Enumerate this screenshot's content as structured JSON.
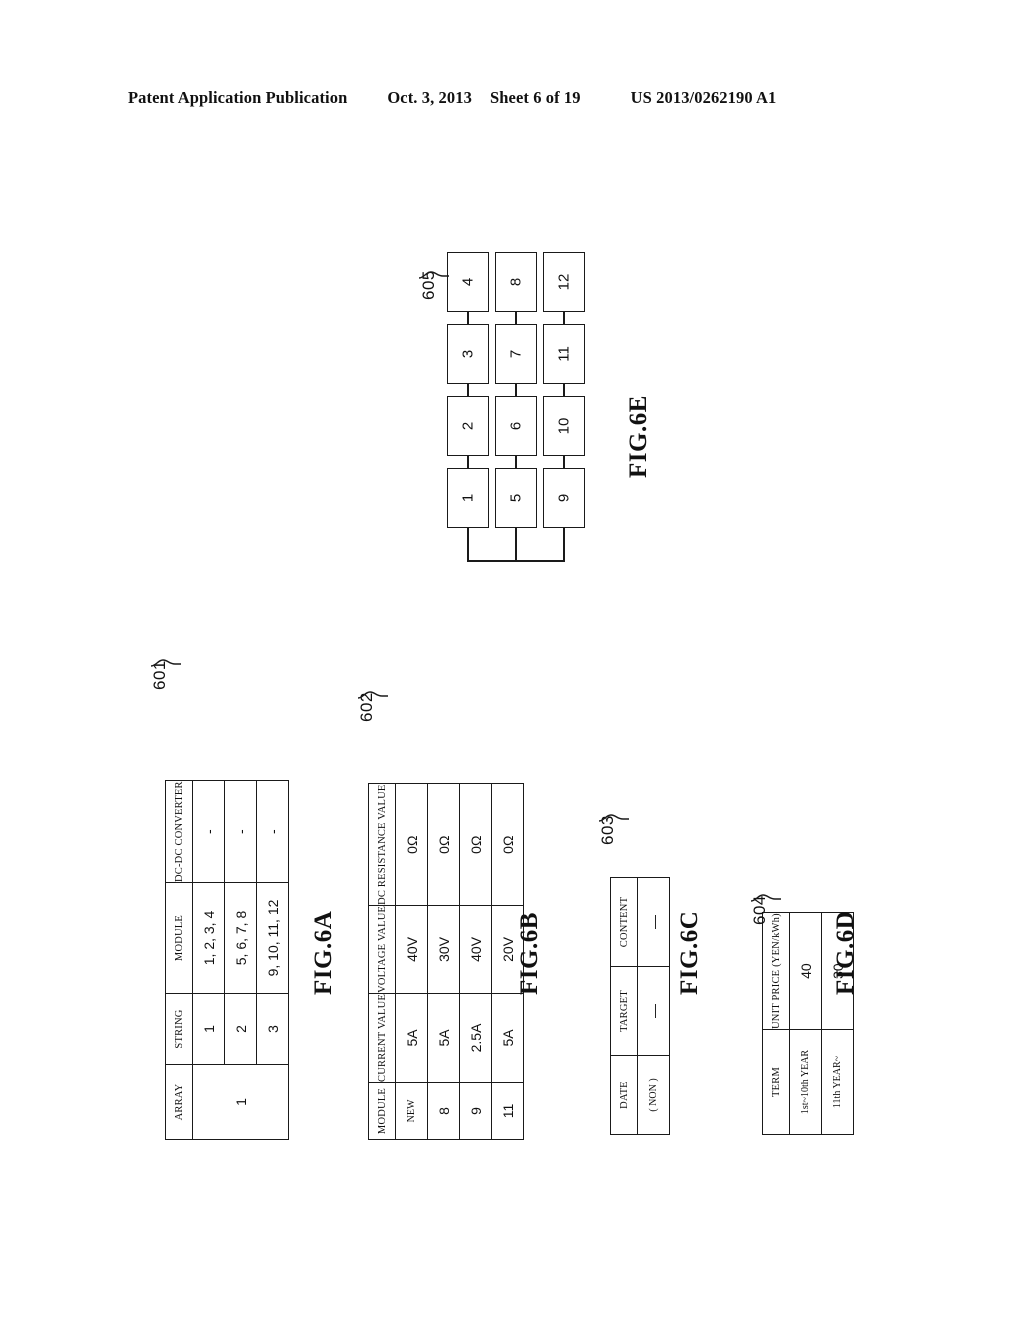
{
  "header": {
    "publication": "Patent Application Publication",
    "date": "Oct. 3, 2013",
    "sheet": "Sheet 6 of 19",
    "number": "US 2013/0262190 A1"
  },
  "figures": {
    "fig6a": {
      "caption": "FIG.6A",
      "ref": "601",
      "columns": [
        "ARRAY",
        "STRING",
        "MODULE",
        "DC-DC CONVERTER"
      ],
      "array_value": "1",
      "rows": [
        {
          "string": "1",
          "module": "1, 2, 3, 4",
          "converter": "-"
        },
        {
          "string": "2",
          "module": "5, 6, 7, 8",
          "converter": "-"
        },
        {
          "string": "3",
          "module": "9, 10, 11, 12",
          "converter": "-"
        }
      ]
    },
    "fig6b": {
      "caption": "FIG.6B",
      "ref": "602",
      "columns": [
        "MODULE",
        "CURRENT VALUE",
        "VOLTAGE VALUE",
        "DC RESISTANCE VALUE"
      ],
      "rows": [
        {
          "module": "NEW",
          "current": "5A",
          "voltage": "40V",
          "resistance": "0Ω"
        },
        {
          "module": "8",
          "current": "5A",
          "voltage": "30V",
          "resistance": "0Ω"
        },
        {
          "module": "9",
          "current": "2.5A",
          "voltage": "40V",
          "resistance": "0Ω"
        },
        {
          "module": "11",
          "current": "5A",
          "voltage": "20V",
          "resistance": "0Ω"
        }
      ]
    },
    "fig6c": {
      "caption": "FIG.6C",
      "ref": "603",
      "columns": [
        "DATE",
        "TARGET",
        "CONTENT"
      ],
      "rows": [
        {
          "date": "( NON )",
          "target": "—",
          "content": "—"
        }
      ]
    },
    "fig6d": {
      "caption": "FIG.6D",
      "ref": "604",
      "columns": [
        "TERM",
        "UNIT PRICE (YEN/kWh)"
      ],
      "rows": [
        {
          "term": "1st~10th YEAR",
          "price": "40"
        },
        {
          "term": "11th YEAR~",
          "price": "30"
        }
      ]
    },
    "fig6e": {
      "caption": "FIG.6E",
      "ref": "605",
      "strings": [
        {
          "modules": [
            "1",
            "2",
            "3",
            "4"
          ]
        },
        {
          "modules": [
            "5",
            "6",
            "7",
            "8"
          ]
        },
        {
          "modules": [
            "9",
            "10",
            "11",
            "12"
          ]
        }
      ]
    }
  }
}
